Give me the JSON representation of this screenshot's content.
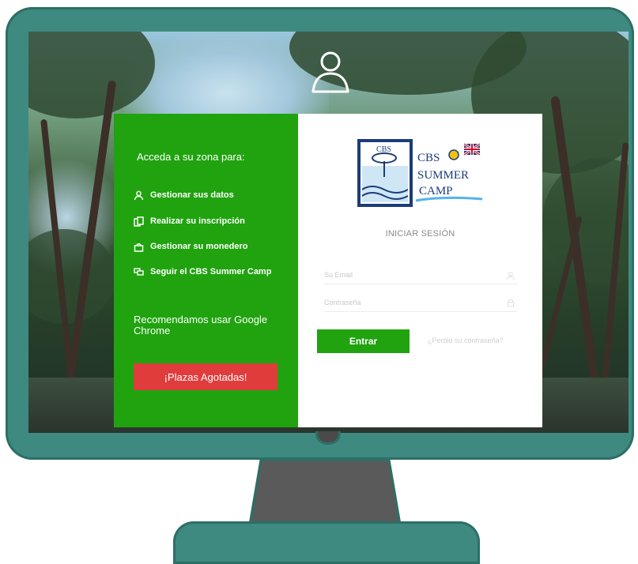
{
  "left_panel": {
    "heading": "Acceda a su zona para:",
    "features": [
      {
        "label": "Gestionar sus datos",
        "icon": "user-icon"
      },
      {
        "label": "Realizar su inscripción",
        "icon": "documents-icon"
      },
      {
        "label": "Gestionar su monedero",
        "icon": "purse-icon"
      },
      {
        "label": "Seguir el CBS Summer Camp",
        "icon": "chat-icon"
      }
    ],
    "recommend": "Recomendamos usar Google Chrome",
    "sold_out_button": "¡Plazas Agotadas!"
  },
  "right_panel": {
    "logo": {
      "badge": "CBS",
      "line1": "CBS",
      "line2": "SUMMER",
      "line3": "CAMP"
    },
    "title": "INICIAR SESIÓN",
    "email_placeholder": "Su Email",
    "password_placeholder": "Contraseña",
    "submit_label": "Entrar",
    "forgot_link": "¿Perdió su contraseña?"
  },
  "colors": {
    "accent_green": "#20a30f",
    "sold_out_red": "#e03c3c",
    "monitor_teal": "#3f8a80"
  }
}
